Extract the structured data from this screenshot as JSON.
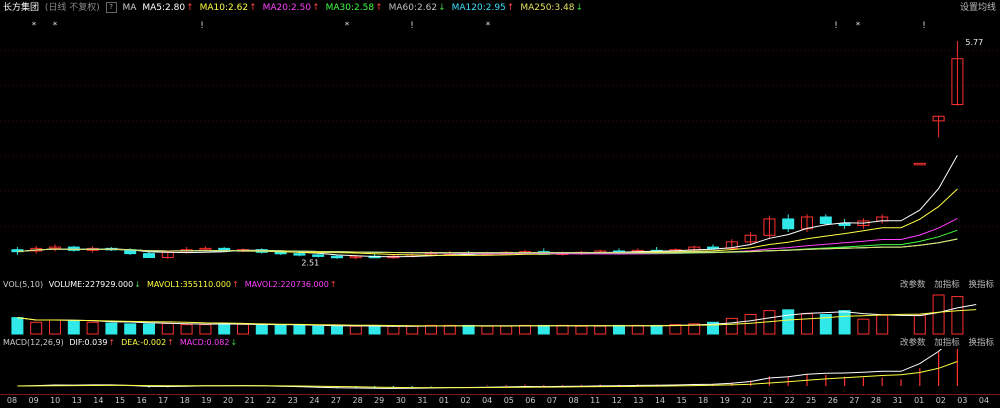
{
  "header": {
    "stock_name": "长方集团",
    "period_label": "(日线 不复权)",
    "help_icon": "?",
    "ma_title": "MA",
    "set_ma_label": "设置均线",
    "ma": [
      {
        "label": "MA5:2.80",
        "arrow": "↑",
        "color": "#ffffff"
      },
      {
        "label": "MA10:2.62",
        "arrow": "↑",
        "color": "#ffff40"
      },
      {
        "label": "MA20:2.50",
        "arrow": "↑",
        "color": "#ff40ff"
      },
      {
        "label": "MA30:2.58",
        "arrow": "↑",
        "color": "#40ff40"
      },
      {
        "label": "MA60:2.62",
        "arrow": "↓",
        "color": "#c0c0c0"
      },
      {
        "label": "MA120:2.95",
        "arrow": "↑",
        "color": "#40e0ff"
      },
      {
        "label": "MA250:3.48",
        "arrow": "↓",
        "color": "#e0e060"
      }
    ]
  },
  "price_panel": {
    "high_label": "5.77",
    "low_label": "2.51",
    "star_icon": "*",
    "excl_icon": "!"
  },
  "volume_panel": {
    "title": "VOL(5,10)",
    "items": [
      {
        "label": "VOLUME:227929.000",
        "arrow": "↓",
        "color": "#ffffff"
      },
      {
        "label": "MAVOL1:355110.000",
        "arrow": "↑",
        "color": "#ffff40"
      },
      {
        "label": "MAVOL2:220736.000",
        "arrow": "↑",
        "color": "#ff40ff"
      }
    ],
    "ctrl_params": "改参数",
    "ctrl_add": "加指标",
    "ctrl_switch": "换指标",
    "volumes": [
      0.42,
      0.3,
      0.36,
      0.34,
      0.3,
      0.28,
      0.26,
      0.26,
      0.27,
      0.24,
      0.24,
      0.27,
      0.25,
      0.22,
      0.22,
      0.22,
      0.2,
      0.2,
      0.2,
      0.2,
      0.2,
      0.2,
      0.22,
      0.22,
      0.22,
      0.2,
      0.2,
      0.22,
      0.22,
      0.22,
      0.2,
      0.2,
      0.22,
      0.22,
      0.22,
      0.24,
      0.26,
      0.3,
      0.4,
      0.5,
      0.6,
      0.62,
      0.52,
      0.5,
      0.6,
      0.38,
      0.48,
      0.42,
      0.48,
      1.0,
      0.96,
      0.92
    ]
  },
  "macd_panel": {
    "title": "MACD(12,26,9)",
    "items": [
      {
        "label": "DIF:0.039",
        "arrow": "↑",
        "color": "#ffffff"
      },
      {
        "label": "DEA:-0.002",
        "arrow": "↑",
        "color": "#ffff40"
      },
      {
        "label": "MACD:0.082",
        "arrow": "↓",
        "color": "#ff40ff"
      }
    ],
    "ctrl_params": "改参数",
    "ctrl_add": "加指标",
    "ctrl_switch": "换指标"
  },
  "candles": [
    [
      2.58,
      2.62,
      2.5,
      2.55
    ],
    [
      2.56,
      2.64,
      2.52,
      2.6
    ],
    [
      2.6,
      2.66,
      2.55,
      2.62
    ],
    [
      2.62,
      2.64,
      2.55,
      2.57
    ],
    [
      2.57,
      2.63,
      2.54,
      2.6
    ],
    [
      2.6,
      2.62,
      2.56,
      2.58
    ],
    [
      2.58,
      2.6,
      2.5,
      2.52
    ],
    [
      2.52,
      2.56,
      2.48,
      2.46
    ],
    [
      2.46,
      2.56,
      2.44,
      2.54
    ],
    [
      2.54,
      2.62,
      2.52,
      2.58
    ],
    [
      2.58,
      2.63,
      2.55,
      2.6
    ],
    [
      2.6,
      2.62,
      2.55,
      2.56
    ],
    [
      2.56,
      2.6,
      2.54,
      2.58
    ],
    [
      2.58,
      2.6,
      2.52,
      2.54
    ],
    [
      2.54,
      2.57,
      2.5,
      2.52
    ],
    [
      2.52,
      2.54,
      2.48,
      2.5
    ],
    [
      2.5,
      2.52,
      2.46,
      2.48
    ],
    [
      2.48,
      2.5,
      2.44,
      2.46
    ],
    [
      2.46,
      2.5,
      2.43,
      2.48
    ],
    [
      2.48,
      2.52,
      2.45,
      2.46
    ],
    [
      2.46,
      2.5,
      2.44,
      2.48
    ],
    [
      2.48,
      2.52,
      2.46,
      2.5
    ],
    [
      2.5,
      2.56,
      2.48,
      2.52
    ],
    [
      2.52,
      2.56,
      2.5,
      2.53
    ],
    [
      2.53,
      2.56,
      2.5,
      2.51
    ],
    [
      2.51,
      2.55,
      2.49,
      2.53
    ],
    [
      2.53,
      2.56,
      2.5,
      2.54
    ],
    [
      2.54,
      2.58,
      2.51,
      2.55
    ],
    [
      2.55,
      2.6,
      2.52,
      2.51
    ],
    [
      2.51,
      2.55,
      2.49,
      2.53
    ],
    [
      2.53,
      2.56,
      2.5,
      2.54
    ],
    [
      2.54,
      2.58,
      2.52,
      2.56
    ],
    [
      2.56,
      2.6,
      2.53,
      2.55
    ],
    [
      2.55,
      2.6,
      2.53,
      2.57
    ],
    [
      2.57,
      2.62,
      2.55,
      2.56
    ],
    [
      2.56,
      2.6,
      2.54,
      2.58
    ],
    [
      2.58,
      2.64,
      2.56,
      2.62
    ],
    [
      2.62,
      2.66,
      2.58,
      2.6
    ],
    [
      2.6,
      2.74,
      2.58,
      2.7
    ],
    [
      2.7,
      2.85,
      2.66,
      2.8
    ],
    [
      2.8,
      3.1,
      2.76,
      3.05
    ],
    [
      3.05,
      3.12,
      2.85,
      2.9
    ],
    [
      2.9,
      3.12,
      2.85,
      3.08
    ],
    [
      3.08,
      3.12,
      2.95,
      2.98
    ],
    [
      2.98,
      3.05,
      2.9,
      2.95
    ],
    [
      2.95,
      3.06,
      2.9,
      3.02
    ],
    [
      3.02,
      3.12,
      2.98,
      3.08
    ],
    [
      null,
      null,
      null,
      null
    ],
    [
      3.9,
      3.9,
      3.9,
      3.9
    ],
    [
      4.55,
      4.62,
      4.3,
      4.62
    ],
    [
      4.8,
      5.77,
      4.78,
      5.5
    ]
  ],
  "x_labels": [
    "08",
    "09",
    "10",
    "13",
    "14",
    "15",
    "16",
    "17",
    "18",
    "19",
    "20",
    "21",
    "22",
    "23",
    "24",
    "27",
    "28",
    "29",
    "30",
    "31",
    "01",
    "02",
    "04",
    "05",
    "06",
    "07",
    "08",
    "11",
    "12",
    "13",
    "14",
    "15",
    "18",
    "19",
    "20",
    "21",
    "22",
    "25",
    "26",
    "27",
    "28",
    "31",
    "01",
    "02",
    "03",
    "04"
  ]
}
